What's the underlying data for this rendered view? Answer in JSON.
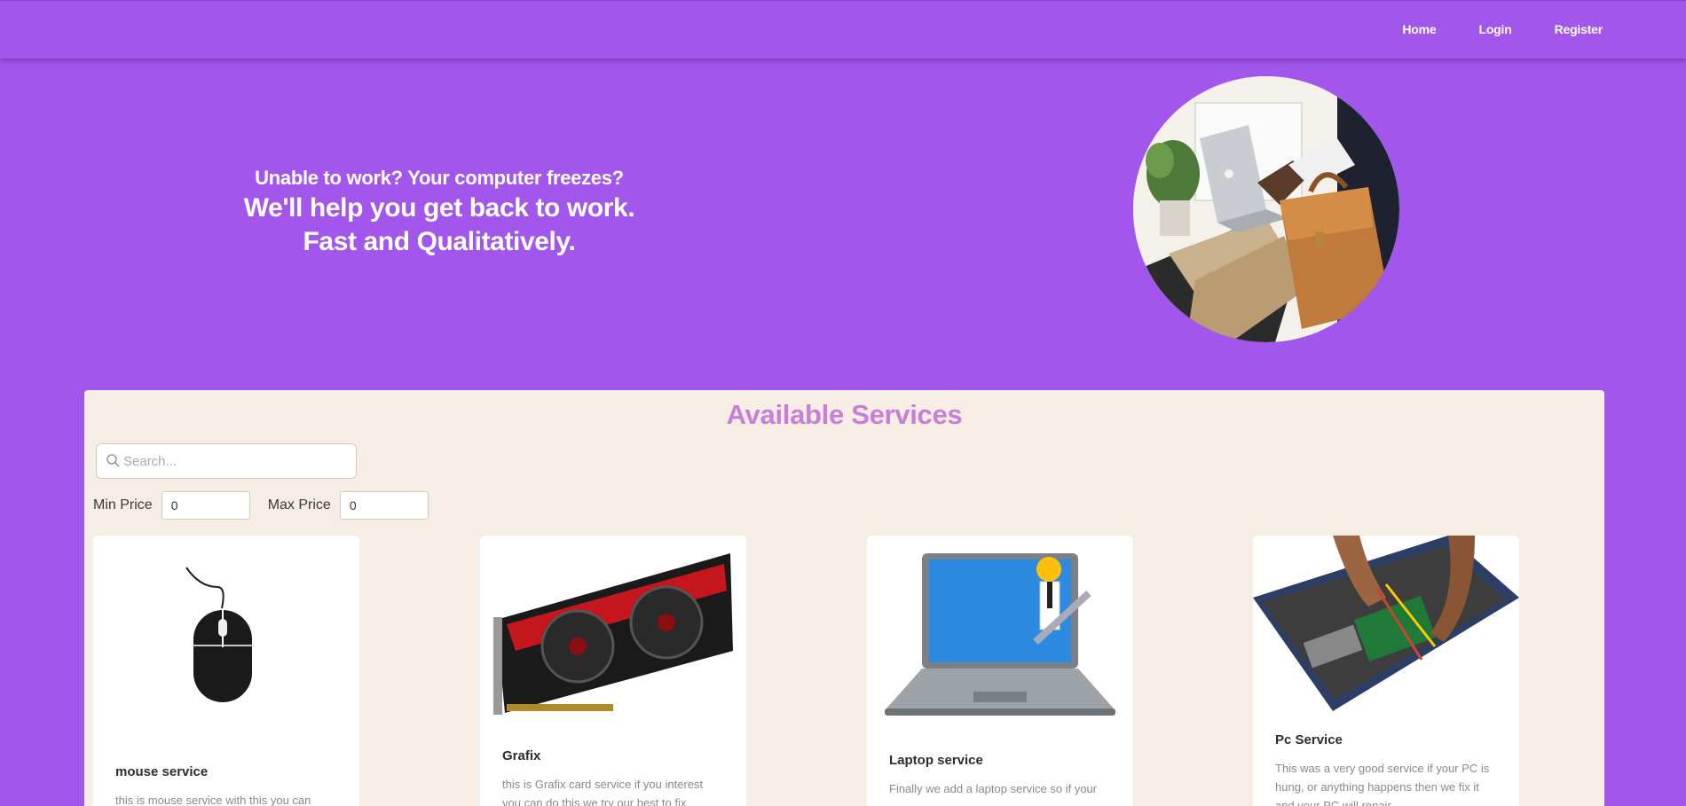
{
  "nav": {
    "home": "Home",
    "login": "Login",
    "register": "Register"
  },
  "hero": {
    "line1": "Unable to work? Your computer freezes?",
    "line2": "We'll help you get back to work.",
    "line3": "Fast and Qualitatively."
  },
  "services": {
    "title": "Available Services",
    "search_placeholder": "Search...",
    "min_price_label": "Min Price",
    "min_price_value": "0",
    "max_price_label": "Max Price",
    "max_price_value": "0",
    "cards": [
      {
        "title": "mouse service",
        "description": "this is mouse service with this you can"
      },
      {
        "title": "Grafix",
        "description": "this is Grafix card service if you interest you can do this we try our best to fix"
      },
      {
        "title": "Laptop service",
        "description": "Finally we add a laptop service so if your"
      },
      {
        "title": "Pc Service",
        "description": "This was a very good service if your PC is hung, or anything happens then we fix it and your PC will repair"
      }
    ]
  },
  "colors": {
    "primary": "#a256eb",
    "panel_bg": "#f6ede4",
    "title_accent": "#c77fd8"
  }
}
